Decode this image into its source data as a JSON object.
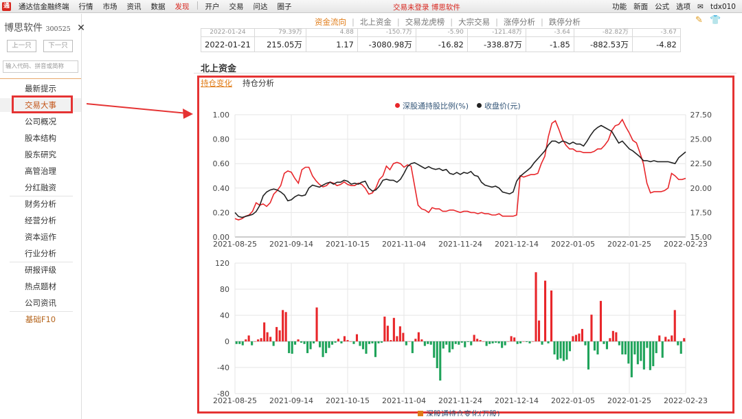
{
  "menubar": {
    "app_title": "通达信金融终端",
    "items": [
      {
        "label": "行情",
        "active": false
      },
      {
        "label": "市场",
        "active": false
      },
      {
        "label": "资讯",
        "active": false
      },
      {
        "label": "数据",
        "active": false
      },
      {
        "label": "发现",
        "active": true
      },
      {
        "label": "开户",
        "active": false
      },
      {
        "label": "交易",
        "active": false
      },
      {
        "label": "问达",
        "active": false
      },
      {
        "label": "圈子",
        "active": false
      }
    ],
    "status_center": "交易未登录   博思软件",
    "right_items": [
      "功能",
      "新面",
      "公式",
      "选项"
    ],
    "user": "tdx010"
  },
  "sidebar": {
    "stock_name": "博思软件",
    "stock_code": "300525",
    "prev_label": "上一只",
    "next_label": "下一只",
    "search_placeholder": "输入代码、拼音或简称",
    "items": [
      {
        "label": "最新提示"
      },
      {
        "label": "交易大事"
      },
      {
        "label": "公司概况"
      },
      {
        "label": "股本结构"
      },
      {
        "label": "股东研究"
      },
      {
        "label": "高管治理"
      },
      {
        "label": "分红融资"
      },
      {
        "label": "财务分析"
      },
      {
        "label": "经营分析"
      },
      {
        "label": "资本运作"
      },
      {
        "label": "行业分析"
      },
      {
        "label": "研报评级"
      },
      {
        "label": "热点题材"
      },
      {
        "label": "公司资讯"
      },
      {
        "label": "基础F10"
      }
    ],
    "active_index": 1
  },
  "top_tabs": [
    "资金流向",
    "北上资金",
    "交易龙虎榜",
    "大宗交易",
    "涨停分析",
    "跌停分析"
  ],
  "top_tabs_active": 0,
  "table": {
    "partial_row": [
      "2022-01-24",
      "79.39万",
      "4.88",
      "-150.7万",
      "-5.90",
      "-121.48万",
      "-3.64",
      "-82.82万",
      "-3.67"
    ],
    "rows": [
      [
        "2022-01-21",
        "215.05万",
        "1.17",
        "-3080.98万",
        "-16.82",
        "-338.87万",
        "-1.85",
        "-882.53万",
        "-4.82"
      ]
    ]
  },
  "section_title": "北上资金",
  "subtabs": [
    "持仓变化",
    "持仓分析"
  ],
  "subtabs_active": 0,
  "chart_data": [
    {
      "type": "line",
      "x_ticks": [
        "2021-08-25",
        "2021-09-14",
        "2021-10-15",
        "2021-11-04",
        "2021-11-24",
        "2021-12-14",
        "2022-01-05",
        "2022-01-25",
        "2022-02-23"
      ],
      "y_left_ticks": [
        "1.00",
        "0.80",
        "0.60",
        "0.40",
        "0.20",
        "0.00"
      ],
      "y_right_ticks": [
        "27.50",
        "25.00",
        "22.50",
        "20.00",
        "17.50",
        "15.00"
      ],
      "ylim_left": [
        0,
        1
      ],
      "ylim_right": [
        15,
        27.5
      ],
      "grid": true,
      "legend_position": "top-center",
      "series": [
        {
          "name": "深股通持股比例(%)",
          "color": "#e8262a",
          "axis": "left",
          "values": [
            0.15,
            0.14,
            0.15,
            0.17,
            0.18,
            0.21,
            0.28,
            0.26,
            0.27,
            0.25,
            0.28,
            0.35,
            0.38,
            0.42,
            0.52,
            0.54,
            0.53,
            0.48,
            0.44,
            0.55,
            0.57,
            0.57,
            0.5,
            0.46,
            0.43,
            0.41,
            0.42,
            0.45,
            0.44,
            0.42,
            0.43,
            0.45,
            0.43,
            0.42,
            0.42,
            0.44,
            0.43,
            0.4,
            0.35,
            0.36,
            0.4,
            0.47,
            0.5,
            0.58,
            0.55,
            0.6,
            0.61,
            0.6,
            0.57,
            0.59,
            0.58,
            0.42,
            0.26,
            0.23,
            0.22,
            0.2,
            0.24,
            0.23,
            0.23,
            0.21,
            0.21,
            0.22,
            0.22,
            0.21,
            0.2,
            0.21,
            0.21,
            0.2,
            0.2,
            0.19,
            0.2,
            0.19,
            0.19,
            0.18,
            0.18,
            0.19,
            0.17,
            0.17,
            0.17,
            0.17,
            0.18,
            0.5,
            0.49,
            0.5,
            0.51,
            0.51,
            0.52,
            0.6,
            0.66,
            0.82,
            0.93,
            0.95,
            0.88,
            0.8,
            0.75,
            0.72,
            0.72,
            0.7,
            0.7,
            0.69,
            0.69,
            0.69,
            0.7,
            0.72,
            0.72,
            0.75,
            0.79,
            0.87,
            0.91,
            0.92,
            0.96,
            0.9,
            0.85,
            0.79,
            0.77,
            0.69,
            0.6,
            0.44,
            0.36,
            0.37,
            0.37,
            0.37,
            0.38,
            0.4,
            0.52,
            0.5,
            0.47,
            0.47,
            0.48
          ]
        },
        {
          "name": "收盘价(元)",
          "color": "#222222",
          "axis": "right",
          "values": [
            17.5,
            17.1,
            17.0,
            17.1,
            17.2,
            17.3,
            17.6,
            18.2,
            19.2,
            19.6,
            19.8,
            19.9,
            19.8,
            19.6,
            19.3,
            18.7,
            18.8,
            19.1,
            19.3,
            19.2,
            19.3,
            20.0,
            20.3,
            20.2,
            20.1,
            20.3,
            20.5,
            20.6,
            20.4,
            20.6,
            20.6,
            20.8,
            20.7,
            20.4,
            20.5,
            20.4,
            20.6,
            20.7,
            20.0,
            19.7,
            19.8,
            20.2,
            20.8,
            20.9,
            20.8,
            20.8,
            20.6,
            20.9,
            21.5,
            22.2,
            22.5,
            22.6,
            22.4,
            22.2,
            22.0,
            22.2,
            22.0,
            21.9,
            22.0,
            21.8,
            21.9,
            21.5,
            21.4,
            21.6,
            21.4,
            21.6,
            21.5,
            21.7,
            21.3,
            21.2,
            20.6,
            20.3,
            20.2,
            20.1,
            20.2,
            20.0,
            19.6,
            19.5,
            19.4,
            19.6,
            20.7,
            21.2,
            21.5,
            21.8,
            22.1,
            22.6,
            23.0,
            23.4,
            23.8,
            24.4,
            24.8,
            24.8,
            24.6,
            24.8,
            24.7,
            24.5,
            24.7,
            24.5,
            24.5,
            24.3,
            24.8,
            25.4,
            25.9,
            26.2,
            26.4,
            26.2,
            26.0,
            25.8,
            25.2,
            24.6,
            24.8,
            24.4,
            24.0,
            23.8,
            23.5,
            23.2,
            22.8,
            22.8,
            22.7,
            22.8,
            22.7,
            22.7,
            22.7,
            22.7,
            22.6,
            22.5,
            23.1,
            23.4,
            23.7
          ]
        }
      ]
    },
    {
      "type": "bar",
      "x_ticks": [
        "2021-08-25",
        "2021-09-14",
        "2021-10-15",
        "2021-11-04",
        "2021-11-24",
        "2021-12-14",
        "2022-01-05",
        "2022-01-25",
        "2022-02-23"
      ],
      "y_ticks": [
        "120",
        "80",
        "40",
        "0",
        "-40",
        "-80"
      ],
      "ylim": [
        -80,
        120
      ],
      "grid": true,
      "series": [
        {
          "name": "深股通持仓变化(万股)",
          "positive_color": "#e8262a",
          "negative_color": "#1fa35a",
          "values": [
            -4,
            -4,
            -6,
            3,
            9,
            -6,
            0,
            3,
            5,
            29,
            14,
            7,
            -7,
            22,
            17,
            48,
            45,
            -18,
            -19,
            -5,
            3,
            -2,
            -4,
            -18,
            -12,
            -3,
            52,
            -9,
            -24,
            -18,
            -10,
            -5,
            -2,
            4,
            -3,
            8,
            2,
            0,
            -4,
            11,
            -7,
            -12,
            -19,
            -4,
            -3,
            -24,
            -3,
            -2,
            38,
            24,
            2,
            36,
            8,
            23,
            13,
            -6,
            0,
            -18,
            4,
            14,
            3,
            -7,
            -4,
            -5,
            -25,
            -41,
            -60,
            -11,
            -5,
            -17,
            -12,
            -4,
            -5,
            -2,
            -9,
            -1,
            -6,
            10,
            4,
            2,
            0,
            -7,
            -4,
            -3,
            -2,
            -3,
            -10,
            -6,
            0,
            8,
            6,
            -4,
            -3,
            0,
            -1,
            -3,
            0,
            106,
            32,
            -5,
            93,
            -3,
            78,
            -20,
            -28,
            -26,
            -30,
            -28,
            -15,
            8,
            10,
            12,
            19,
            -6,
            -43,
            41,
            -14,
            -20,
            62,
            -4,
            -12,
            5,
            16,
            14,
            -6,
            -20,
            -20,
            -34,
            -55,
            -20,
            -35,
            -30,
            -43,
            -10,
            -44,
            -38,
            -18,
            9,
            -25,
            7,
            3,
            9,
            48,
            -6,
            -19,
            5
          ]
        }
      ]
    }
  ]
}
